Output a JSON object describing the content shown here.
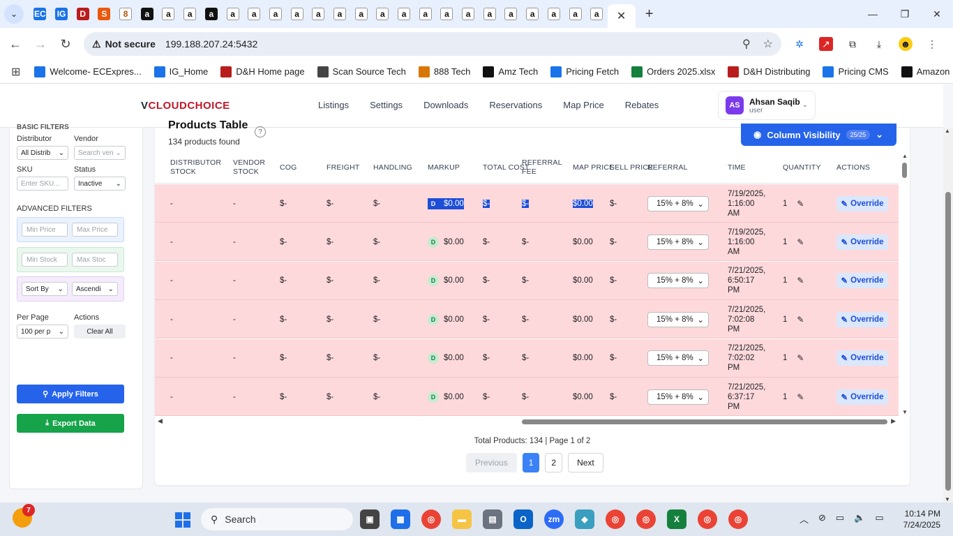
{
  "browser": {
    "tab_count_icons": [
      "ec",
      "ig",
      "dh",
      "sst",
      "888",
      "amz",
      "a",
      "a",
      "amz",
      "a",
      "a",
      "a",
      "a",
      "a",
      "a",
      "a",
      "a",
      "a",
      "a",
      "a",
      "a",
      "a",
      "a",
      "a",
      "a",
      "a",
      "a"
    ],
    "url_secure_label": "Not secure",
    "url": "199.188.207.24:5432",
    "bookmarks": [
      {
        "label": "Welcome- ECExpres...",
        "icon": "ec-icon",
        "color": "#1a73e8"
      },
      {
        "label": "IG_Home",
        "icon": "ig-icon",
        "color": "#1a73e8"
      },
      {
        "label": "D&H Home page",
        "icon": "dh-icon",
        "color": "#b91c1c"
      },
      {
        "label": "Scan Source Tech",
        "icon": "globe-icon",
        "color": "#444444"
      },
      {
        "label": "888 Tech",
        "icon": "888-icon",
        "color": "#d97706"
      },
      {
        "label": "Amz Tech",
        "icon": "amazon-icon",
        "color": "#111111"
      },
      {
        "label": "Pricing Fetch",
        "icon": "dollar-icon",
        "color": "#1a73e8"
      },
      {
        "label": "Orders 2025.xlsx",
        "icon": "excel-icon",
        "color": "#15803d"
      },
      {
        "label": "D&H Distributing",
        "icon": "dh-icon",
        "color": "#b91c1c"
      },
      {
        "label": "Pricing CMS",
        "icon": "dollar-icon",
        "color": "#1a73e8"
      },
      {
        "label": "Amazon",
        "icon": "amazon-icon",
        "color": "#111111"
      }
    ]
  },
  "app": {
    "logo_v": "V",
    "logo_text": "CLOUDCHOICE",
    "nav": [
      "Listings",
      "Settings",
      "Downloads",
      "Reservations",
      "Map Price",
      "Rebates"
    ],
    "user": {
      "initials": "AS",
      "name": "Ahsan Saqib",
      "role": "user"
    }
  },
  "sidebar": {
    "cut_heading": "BASIC FILTERS",
    "distributor_label": "Distributor",
    "distributor_value": "All Distrib",
    "vendor_label": "Vendor",
    "vendor_placeholder": "Search ven",
    "sku_label": "SKU",
    "sku_placeholder": "Enter SKU...",
    "status_label": "Status",
    "status_value": "Inactive",
    "advanced_title": "ADVANCED FILTERS",
    "min_price": "Min Price",
    "max_price": "Max Price",
    "min_stock": "Min Stock",
    "max_stock": "Max Stoc",
    "sort_by": "Sort By",
    "sort_order": "Ascendi",
    "per_page_label": "Per Page",
    "per_page_value": "100 per p",
    "actions_label": "Actions",
    "clear_all": "Clear All",
    "apply_filters": "Apply Filters",
    "export_data": "Export Data"
  },
  "panel": {
    "title": "Products Table",
    "subtitle": "134 products found",
    "column_visibility": "Column Visibility",
    "column_badge": "25/25",
    "columns": [
      {
        "key": "dist",
        "label": "DISTRIBUTOR STOCK"
      },
      {
        "key": "vend",
        "label": "VENDOR STOCK"
      },
      {
        "key": "cog",
        "label": "COG"
      },
      {
        "key": "freight",
        "label": "FREIGHT"
      },
      {
        "key": "handling",
        "label": "HANDLING"
      },
      {
        "key": "markup",
        "label": "MARKUP"
      },
      {
        "key": "total",
        "label": "TOTAL COST"
      },
      {
        "key": "ref_fee",
        "label": "REFERRAL FEE"
      },
      {
        "key": "map",
        "label": "MAP PRICE"
      },
      {
        "key": "sell",
        "label": "SELL PRICE"
      },
      {
        "key": "referral",
        "label": "REFERRAL"
      },
      {
        "key": "time",
        "label": "TIME"
      },
      {
        "key": "qty",
        "label": "QUANTITY"
      },
      {
        "key": "actions",
        "label": "ACTIONS"
      }
    ],
    "rows": [
      {
        "dist": "-",
        "vend": "-",
        "cog": "$-",
        "freight": "$-",
        "handling": "$-",
        "badge": "D",
        "markup": "$0.00",
        "total": "$-",
        "ref_fee": "$-",
        "map": "$0.00",
        "sell": "$-",
        "referral": "15% + 8%",
        "time1": "7/19/2025,",
        "time2": "1:16:00",
        "time3": "AM",
        "qty": "1",
        "action": "Override",
        "highlight": true
      },
      {
        "dist": "-",
        "vend": "-",
        "cog": "$-",
        "freight": "$-",
        "handling": "$-",
        "badge": "D",
        "markup": "$0.00",
        "total": "$-",
        "ref_fee": "$-",
        "map": "$0.00",
        "sell": "$-",
        "referral": "15% + 8%",
        "time1": "7/19/2025,",
        "time2": "1:16:00",
        "time3": "AM",
        "qty": "1",
        "action": "Override"
      },
      {
        "dist": "-",
        "vend": "-",
        "cog": "$-",
        "freight": "$-",
        "handling": "$-",
        "badge": "D",
        "markup": "$0.00",
        "total": "$-",
        "ref_fee": "$-",
        "map": "$0.00",
        "sell": "$-",
        "referral": "15% + 8%",
        "time1": "7/21/2025,",
        "time2": "6:50:17",
        "time3": "PM",
        "qty": "1",
        "action": "Override"
      },
      {
        "dist": "-",
        "vend": "-",
        "cog": "$-",
        "freight": "$-",
        "handling": "$-",
        "badge": "D",
        "markup": "$0.00",
        "total": "$-",
        "ref_fee": "$-",
        "map": "$0.00",
        "sell": "$-",
        "referral": "15% + 8%",
        "time1": "7/21/2025,",
        "time2": "7:02:08",
        "time3": "PM",
        "qty": "1",
        "action": "Override"
      },
      {
        "dist": "-",
        "vend": "-",
        "cog": "$-",
        "freight": "$-",
        "handling": "$-",
        "badge": "D",
        "markup": "$0.00",
        "total": "$-",
        "ref_fee": "$-",
        "map": "$0.00",
        "sell": "$-",
        "referral": "15% + 8%",
        "time1": "7/21/2025,",
        "time2": "7:02:02",
        "time3": "PM",
        "qty": "1",
        "action": "Override"
      },
      {
        "dist": "-",
        "vend": "-",
        "cog": "$-",
        "freight": "$-",
        "handling": "$-",
        "badge": "D",
        "markup": "$0.00",
        "total": "$-",
        "ref_fee": "$-",
        "map": "$0.00",
        "sell": "$-",
        "referral": "15% + 8%",
        "time1": "7/21/2025,",
        "time2": "6:37:17",
        "time3": "PM",
        "qty": "1",
        "action": "Override"
      }
    ],
    "footer_total": "Total Products: 134 | Page 1 of 2",
    "pager": {
      "previous": "Previous",
      "pages": [
        "1",
        "2"
      ],
      "current": "1",
      "next": "Next"
    }
  },
  "taskbar": {
    "weather_badge": "7",
    "search_placeholder": "Search",
    "time": "10:14 PM",
    "date": "7/24/2025"
  },
  "colors": {
    "primary": "#2563eb",
    "success": "#16a34a",
    "row_bg": "#fdd9dc",
    "brand_red": "#c0182a"
  }
}
